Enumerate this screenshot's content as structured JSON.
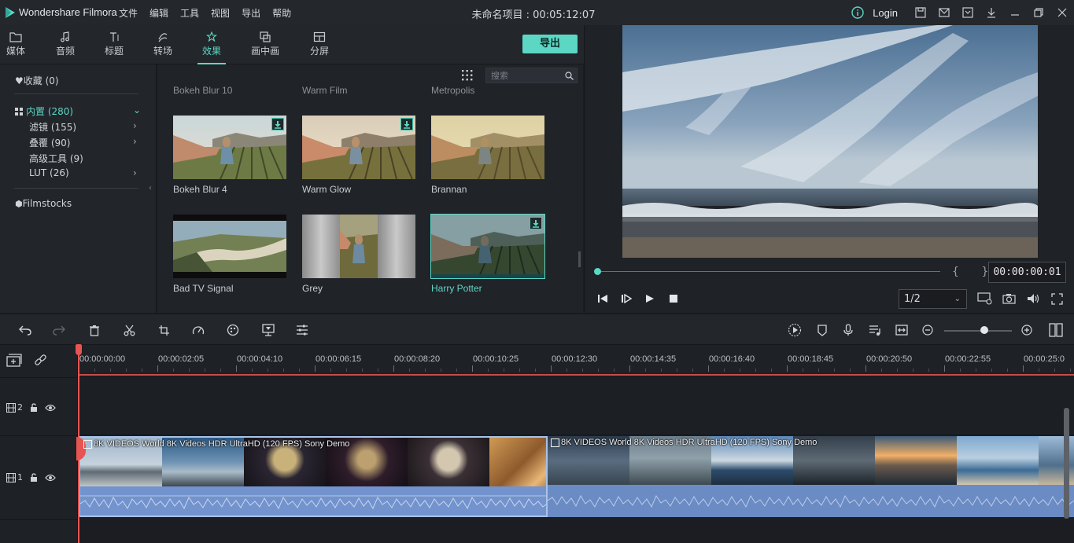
{
  "app": {
    "name": "Wondershare Filmora",
    "project_title": "未命名项目 : 00:05:12:07",
    "login_label": "Login",
    "accent": "#5cd7c4"
  },
  "menu": [
    "文件",
    "编辑",
    "工具",
    "视图",
    "导出",
    "帮助"
  ],
  "tabs": [
    {
      "label": "媒体",
      "icon": "folder-icon"
    },
    {
      "label": "音频",
      "icon": "music-note-icon"
    },
    {
      "label": "标题",
      "icon": "text-icon"
    },
    {
      "label": "转场",
      "icon": "transition-icon"
    },
    {
      "label": "效果",
      "icon": "effects-icon",
      "active": true
    },
    {
      "label": "画中画",
      "icon": "pip-icon"
    },
    {
      "label": "分屏",
      "icon": "split-screen-icon"
    }
  ],
  "export_label": "导出",
  "library": {
    "favorites": "收藏 (0)",
    "builtin": "内置 (280)",
    "filters": "滤镜 (155)",
    "overlays": "叠覆 (90)",
    "advanced": "高级工具 (9)",
    "lut": "LUT (26)",
    "filmstocks": "Filmstocks"
  },
  "search": {
    "placeholder": "搜索"
  },
  "effects_cutoff": [
    "Bokeh Blur 10",
    "Warm Film",
    "Metropolis"
  ],
  "effects": [
    {
      "label": "Bokeh Blur 4",
      "download": true
    },
    {
      "label": "Warm Glow",
      "download": true
    },
    {
      "label": "Brannan",
      "download": false
    },
    {
      "label": "Bad TV Signal",
      "download": false
    },
    {
      "label": "Grey",
      "download": false
    },
    {
      "label": "Harry Potter",
      "download": true,
      "selected": true
    }
  ],
  "preview": {
    "timecode": "00:00:00:01",
    "quality": "1/2",
    "brackets": "{ }"
  },
  "ruler_labels": [
    "00:00:00:00",
    "00:00:02:05",
    "00:00:04:10",
    "00:00:06:15",
    "00:00:08:20",
    "00:00:10:25",
    "00:00:12:30",
    "00:00:14:35",
    "00:00:16:40",
    "00:00:18:45",
    "00:00:20:50",
    "00:00:22:55",
    "00:00:25:0"
  ],
  "tracks": [
    {
      "label": "2"
    },
    {
      "label": "1"
    }
  ],
  "clips": [
    {
      "name": "8K VIDEOS   World 8K Videos HDR UltraHD  (120 FPS)  Sony Demo",
      "selected": true
    },
    {
      "name": "8K VIDEOS   World 8K Videos HDR UltraHD  (120 FPS)  Sony Demo",
      "selected": false
    }
  ]
}
